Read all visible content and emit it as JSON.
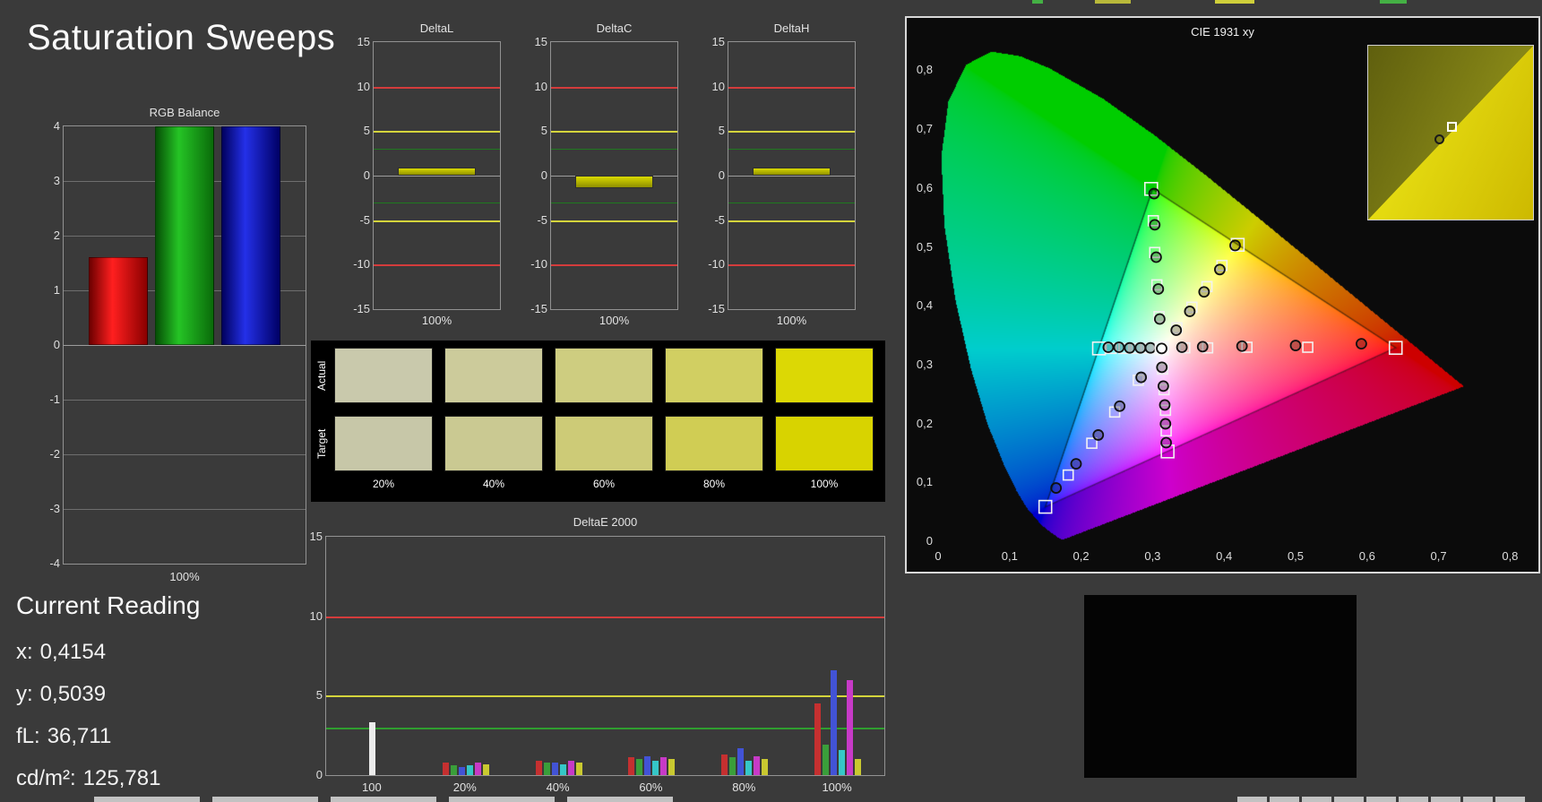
{
  "page": {
    "title": "Saturation Sweeps"
  },
  "current_reading": {
    "heading": "Current Reading",
    "rows": [
      {
        "label": "x:",
        "value": "0,4154"
      },
      {
        "label": "y:",
        "value": "0,5039"
      },
      {
        "label": "fL:",
        "value": "36,711"
      },
      {
        "label": "cd/m²:",
        "value": "125,781"
      }
    ]
  },
  "swatch_panel": {
    "row_labels": [
      "Actual",
      "Target"
    ],
    "percent_labels": [
      "20%",
      "40%",
      "60%",
      "80%",
      "100%"
    ],
    "actual_colors": [
      "#c9c9ac",
      "#cccb9b",
      "#cecd80",
      "#d1cf62",
      "#dcd805"
    ],
    "target_colors": [
      "#c7c7a8",
      "#cac992",
      "#cdcb77",
      "#d0cd54",
      "#d8d300"
    ]
  },
  "inset": {
    "target_color_dark": "#5f5f0e",
    "target_color_light": "#9d9d1c",
    "actual_color_light": "#f2ee1a",
    "actual_color_dark": "#cdb900"
  },
  "chart_data": [
    {
      "id": "rgb_balance",
      "type": "bar",
      "title": "RGB Balance",
      "xlabel": "100%",
      "ylim": [
        -4,
        4
      ],
      "yticks": [
        4,
        3,
        2,
        1,
        0,
        -1,
        -2,
        -3,
        -4
      ],
      "categories": [
        "Red",
        "Green",
        "Blue"
      ],
      "values": [
        1.6,
        4,
        4
      ],
      "bar_gradients": [
        [
          "#6e0000",
          "#ff1f1f",
          "#8a0000"
        ],
        [
          "#064f06",
          "#25c425",
          "#0a6b0a"
        ],
        [
          "#00005e",
          "#2430e8",
          "#000066"
        ]
      ]
    },
    {
      "id": "delta_l",
      "type": "bar",
      "title": "DeltaL",
      "xlabel": "100%",
      "ylim": [
        -15,
        15
      ],
      "yticks": [
        15,
        10,
        5,
        0,
        -5,
        -10,
        -15
      ],
      "categories": [
        "100%"
      ],
      "values": [
        0.9
      ],
      "bar_color_top": "#d9d900",
      "bar_color_bottom": "#8f8f00",
      "threshold_lines": [
        {
          "y": 10,
          "color": "#d43c3c"
        },
        {
          "y": 5,
          "color": "#d4d43c"
        },
        {
          "y": 3,
          "color": "#1f7a1f"
        },
        {
          "y": -3,
          "color": "#1f7a1f"
        },
        {
          "y": -5,
          "color": "#d4d43c"
        },
        {
          "y": -10,
          "color": "#d43c3c"
        }
      ]
    },
    {
      "id": "delta_c",
      "type": "bar",
      "title": "DeltaC",
      "xlabel": "100%",
      "ylim": [
        -15,
        15
      ],
      "yticks": [
        15,
        10,
        5,
        0,
        -5,
        -10,
        -15
      ],
      "categories": [
        "100%"
      ],
      "values": [
        -1.4
      ],
      "bar_color_top": "#d9d900",
      "bar_color_bottom": "#8f8f00",
      "threshold_lines": [
        {
          "y": 10,
          "color": "#d43c3c"
        },
        {
          "y": 5,
          "color": "#d4d43c"
        },
        {
          "y": 3,
          "color": "#1f7a1f"
        },
        {
          "y": -3,
          "color": "#1f7a1f"
        },
        {
          "y": -5,
          "color": "#d4d43c"
        },
        {
          "y": -10,
          "color": "#d43c3c"
        }
      ]
    },
    {
      "id": "delta_h",
      "type": "bar",
      "title": "DeltaH",
      "xlabel": "100%",
      "ylim": [
        -15,
        15
      ],
      "yticks": [
        15,
        10,
        5,
        0,
        -5,
        -10,
        -15
      ],
      "categories": [
        "100%"
      ],
      "values": [
        0.9
      ],
      "bar_color_top": "#d9d900",
      "bar_color_bottom": "#8f8f00",
      "threshold_lines": [
        {
          "y": 10,
          "color": "#d43c3c"
        },
        {
          "y": 5,
          "color": "#d4d43c"
        },
        {
          "y": 3,
          "color": "#1f7a1f"
        },
        {
          "y": -3,
          "color": "#1f7a1f"
        },
        {
          "y": -5,
          "color": "#d4d43c"
        },
        {
          "y": -10,
          "color": "#d43c3c"
        }
      ]
    },
    {
      "id": "deltae2000",
      "type": "bar",
      "title": "DeltaE 2000",
      "ylim": [
        0,
        15
      ],
      "yticks": [
        15,
        10,
        5,
        0
      ],
      "threshold_lines": [
        {
          "y": 10,
          "color": "#d43c3c"
        },
        {
          "y": 5,
          "color": "#d4d43c"
        },
        {
          "y": 3,
          "color": "#2f9e2f"
        }
      ],
      "palette": {
        "white": "#ececec",
        "red": "#c53030",
        "green": "#3a9e3a",
        "blue": "#4253d6",
        "cyan": "#35c7c7",
        "magenta": "#c73ac7",
        "yellow": "#c9c930"
      },
      "groups": [
        {
          "label": "100",
          "bars": [
            {
              "c": "white",
              "v": 3.3
            }
          ]
        },
        {
          "label": "20%",
          "bars": [
            {
              "c": "red",
              "v": 0.8
            },
            {
              "c": "green",
              "v": 0.6
            },
            {
              "c": "blue",
              "v": 0.5
            },
            {
              "c": "cyan",
              "v": 0.6
            },
            {
              "c": "magenta",
              "v": 0.8
            },
            {
              "c": "yellow",
              "v": 0.7
            }
          ]
        },
        {
          "label": "40%",
          "bars": [
            {
              "c": "red",
              "v": 0.9
            },
            {
              "c": "green",
              "v": 0.8
            },
            {
              "c": "blue",
              "v": 0.8
            },
            {
              "c": "cyan",
              "v": 0.7
            },
            {
              "c": "magenta",
              "v": 0.9
            },
            {
              "c": "yellow",
              "v": 0.8
            }
          ]
        },
        {
          "label": "60%",
          "bars": [
            {
              "c": "red",
              "v": 1.1
            },
            {
              "c": "green",
              "v": 1.0
            },
            {
              "c": "blue",
              "v": 1.2
            },
            {
              "c": "cyan",
              "v": 0.9
            },
            {
              "c": "magenta",
              "v": 1.1
            },
            {
              "c": "yellow",
              "v": 1.0
            }
          ]
        },
        {
          "label": "80%",
          "bars": [
            {
              "c": "red",
              "v": 1.3
            },
            {
              "c": "green",
              "v": 1.1
            },
            {
              "c": "blue",
              "v": 1.7
            },
            {
              "c": "cyan",
              "v": 0.9
            },
            {
              "c": "magenta",
              "v": 1.2
            },
            {
              "c": "yellow",
              "v": 1.0
            }
          ]
        },
        {
          "label": "100%",
          "bars": [
            {
              "c": "red",
              "v": 4.5
            },
            {
              "c": "green",
              "v": 1.9
            },
            {
              "c": "blue",
              "v": 6.6
            },
            {
              "c": "cyan",
              "v": 1.6
            },
            {
              "c": "magenta",
              "v": 6.0
            },
            {
              "c": "yellow",
              "v": 1.0
            }
          ]
        }
      ]
    },
    {
      "id": "cie1931",
      "type": "scatter",
      "title": "CIE 1931 xy",
      "xlim": [
        0,
        0.8
      ],
      "ylim": [
        0,
        0.8
      ],
      "xtick_labels": [
        "0",
        "0,1",
        "0,2",
        "0,3",
        "0,4",
        "0,5",
        "0,6",
        "0,7",
        "0,8"
      ],
      "ytick_labels": [
        "0",
        "0,1",
        "0,2",
        "0,3",
        "0,4",
        "0,5",
        "0,6",
        "0,7",
        "0,8"
      ],
      "white_point": [
        0.3127,
        0.329
      ],
      "gamut_triangle": {
        "red": [
          0.64,
          0.33
        ],
        "green": [
          0.3,
          0.6
        ],
        "blue": [
          0.15,
          0.06
        ]
      },
      "sweeps": [
        {
          "name": "red",
          "targets": [
            [
              0.345,
              0.33
            ],
            [
              0.377,
              0.33
            ],
            [
              0.432,
              0.331
            ],
            [
              0.517,
              0.331
            ],
            [
              0.64,
              0.33
            ]
          ],
          "measured": [
            [
              0.341,
              0.331
            ],
            [
              0.37,
              0.332
            ],
            [
              0.425,
              0.333
            ],
            [
              0.5,
              0.334
            ],
            [
              0.592,
              0.337
            ]
          ]
        },
        {
          "name": "yellow",
          "targets": [
            [
              0.334,
              0.364
            ],
            [
              0.355,
              0.399
            ],
            [
              0.376,
              0.434
            ],
            [
              0.397,
              0.47
            ],
            [
              0.419,
              0.505
            ]
          ],
          "measured": [
            [
              0.333,
              0.36
            ],
            [
              0.352,
              0.392
            ],
            [
              0.372,
              0.425
            ],
            [
              0.394,
              0.463
            ],
            [
              0.4154,
              0.5039
            ]
          ]
        },
        {
          "name": "green",
          "targets": [
            [
              0.309,
              0.383
            ],
            [
              0.306,
              0.437
            ],
            [
              0.303,
              0.492
            ],
            [
              0.301,
              0.546
            ],
            [
              0.298,
              0.6
            ]
          ],
          "measured": [
            [
              0.31,
              0.379
            ],
            [
              0.308,
              0.43
            ],
            [
              0.305,
              0.484
            ],
            [
              0.303,
              0.539
            ],
            [
              0.302,
              0.592
            ]
          ]
        },
        {
          "name": "cyan",
          "targets": [
            [
              0.295,
              0.329
            ],
            [
              0.277,
              0.329
            ],
            [
              0.26,
              0.329
            ],
            [
              0.242,
              0.329
            ],
            [
              0.225,
              0.329
            ]
          ],
          "measured": [
            [
              0.297,
              0.33
            ],
            [
              0.283,
              0.33
            ],
            [
              0.268,
              0.33
            ],
            [
              0.253,
              0.331
            ],
            [
              0.238,
              0.331
            ]
          ]
        },
        {
          "name": "magenta",
          "targets": [
            [
              0.314,
              0.294
            ],
            [
              0.316,
              0.259
            ],
            [
              0.318,
              0.224
            ],
            [
              0.319,
              0.189
            ],
            [
              0.321,
              0.154
            ]
          ],
          "measured": [
            [
              0.313,
              0.297
            ],
            [
              0.315,
              0.265
            ],
            [
              0.317,
              0.233
            ],
            [
              0.318,
              0.201
            ],
            [
              0.319,
              0.169
            ]
          ]
        },
        {
          "name": "blue",
          "targets": [
            [
              0.28,
              0.275
            ],
            [
              0.247,
              0.221
            ],
            [
              0.215,
              0.168
            ],
            [
              0.182,
              0.114
            ],
            [
              0.15,
              0.06
            ]
          ],
          "measured": [
            [
              0.284,
              0.28
            ],
            [
              0.254,
              0.231
            ],
            [
              0.224,
              0.182
            ],
            [
              0.193,
              0.133
            ],
            [
              0.165,
              0.092
            ]
          ]
        }
      ]
    }
  ]
}
